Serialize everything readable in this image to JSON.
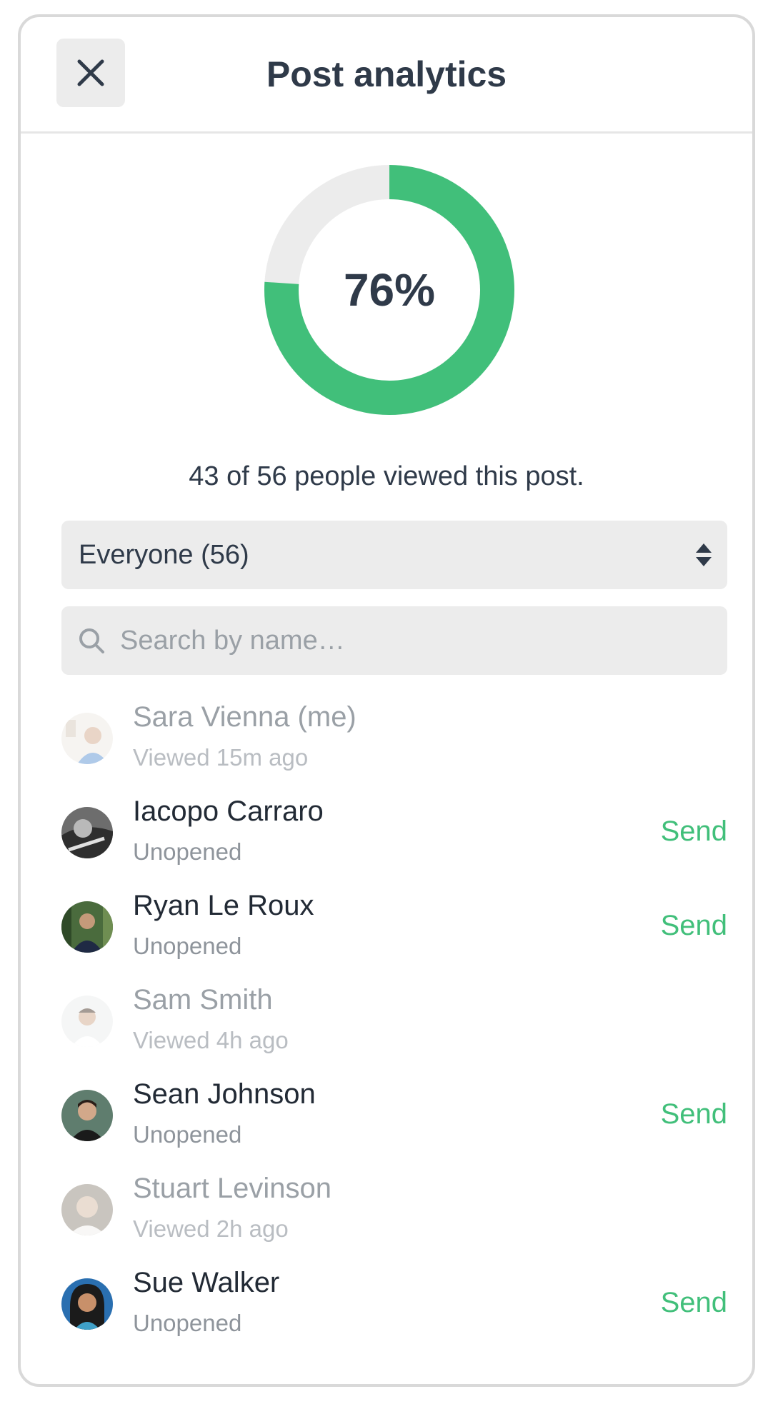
{
  "header": {
    "title": "Post analytics"
  },
  "summary": {
    "percent": 76,
    "percent_label": "76%",
    "viewed_text": "43 of 56 people viewed this post."
  },
  "filter": {
    "selected": "Everyone (56)"
  },
  "search": {
    "placeholder": "Search by name…"
  },
  "colors": {
    "accent": "#41bf7a",
    "track": "#ececec",
    "text": "#2f3a49"
  },
  "people": [
    {
      "name": "Sara Vienna (me)",
      "status": "Viewed 15m ago",
      "viewed": true
    },
    {
      "name": "Iacopo Carraro",
      "status": "Unopened",
      "viewed": false,
      "action": "Send"
    },
    {
      "name": "Ryan Le Roux",
      "status": "Unopened",
      "viewed": false,
      "action": "Send"
    },
    {
      "name": "Sam Smith",
      "status": "Viewed 4h ago",
      "viewed": true
    },
    {
      "name": "Sean Johnson",
      "status": "Unopened",
      "viewed": false,
      "action": "Send"
    },
    {
      "name": "Stuart Levinson",
      "status": "Viewed 2h ago",
      "viewed": true
    },
    {
      "name": "Sue Walker",
      "status": "Unopened",
      "viewed": false,
      "action": "Send"
    }
  ]
}
